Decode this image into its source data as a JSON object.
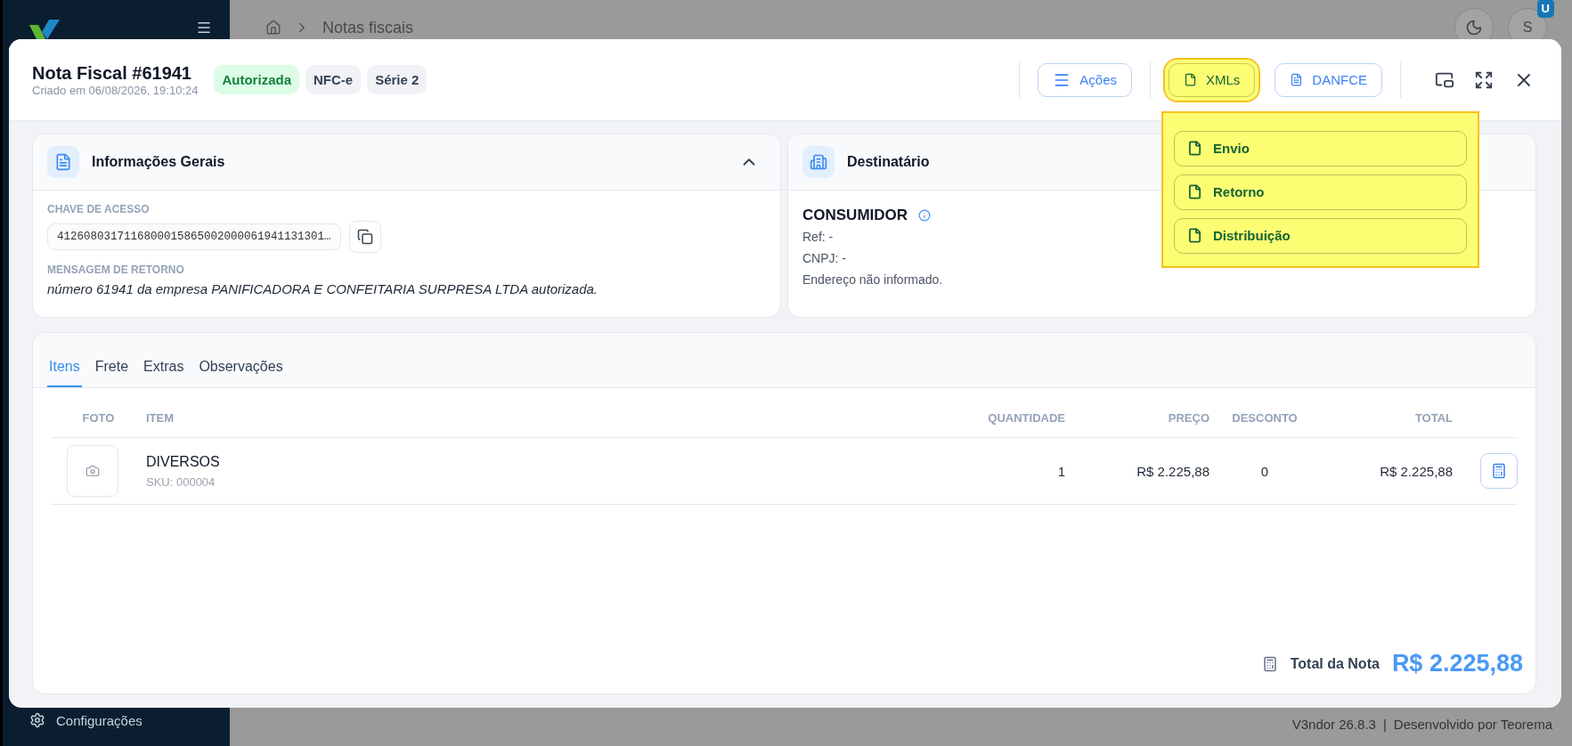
{
  "app": {
    "breadcrumb": "Notas fiscais",
    "avatar": "S",
    "avatar_badge": "U",
    "sidebar_item": "Configurações",
    "footer_version": "V3ndor 26.8.3",
    "footer_separator": "|",
    "footer_credit": "Desenvolvido por Teorema"
  },
  "modal": {
    "title": "Nota Fiscal #61941",
    "subtitle": "Criado em 06/08/2026, 19:10:24",
    "badges": [
      {
        "label": "Autorizada",
        "kind": "success"
      },
      {
        "label": "NFC-e",
        "kind": "neutral"
      },
      {
        "label": "Série 2",
        "kind": "neutral"
      }
    ],
    "actions": [
      {
        "label": "Ações",
        "kind": "menu",
        "open": false
      },
      {
        "label": "XMLs",
        "kind": "file",
        "open": true
      },
      {
        "label": "DANFCE",
        "kind": "pdf",
        "open": false
      }
    ],
    "xml_menu": [
      "Envio",
      "Retorno",
      "Distribuição"
    ],
    "general": {
      "title": "Informações Gerais",
      "expanded": true,
      "key_label": "CHAVE DE ACESSO",
      "key_value": "4126080317116800015865002000061941131301…",
      "message_label": "MENSAGEM DE RETORNO",
      "message": "número 61941 da empresa PANIFICADORA E CONFEITARIA SURPRESA LTDA autorizada."
    },
    "recipient": {
      "title": "Destinatário",
      "name": "CONSUMIDOR",
      "lines": [
        "Ref: -",
        "CNPJ: -",
        "Endereço não informado."
      ]
    },
    "tabs": [
      {
        "label": "Itens",
        "selected": true
      },
      {
        "label": "Frete",
        "selected": false
      },
      {
        "label": "Extras",
        "selected": false
      },
      {
        "label": "Observações",
        "selected": false
      }
    ],
    "table": {
      "columns": [
        "FOTO",
        "ITEM",
        "QUANTIDADE",
        "PREÇO",
        "DESCONTO",
        "TOTAL"
      ],
      "rows": [
        {
          "item": "DIVERSOS",
          "sku": "SKU: 000004",
          "quantity": "1",
          "price": "R$ 2.225,88",
          "discount": "0",
          "total": "R$ 2.225,88"
        }
      ]
    },
    "total": {
      "label": "Total da Nota",
      "value": "R$ 2.225,88"
    }
  }
}
